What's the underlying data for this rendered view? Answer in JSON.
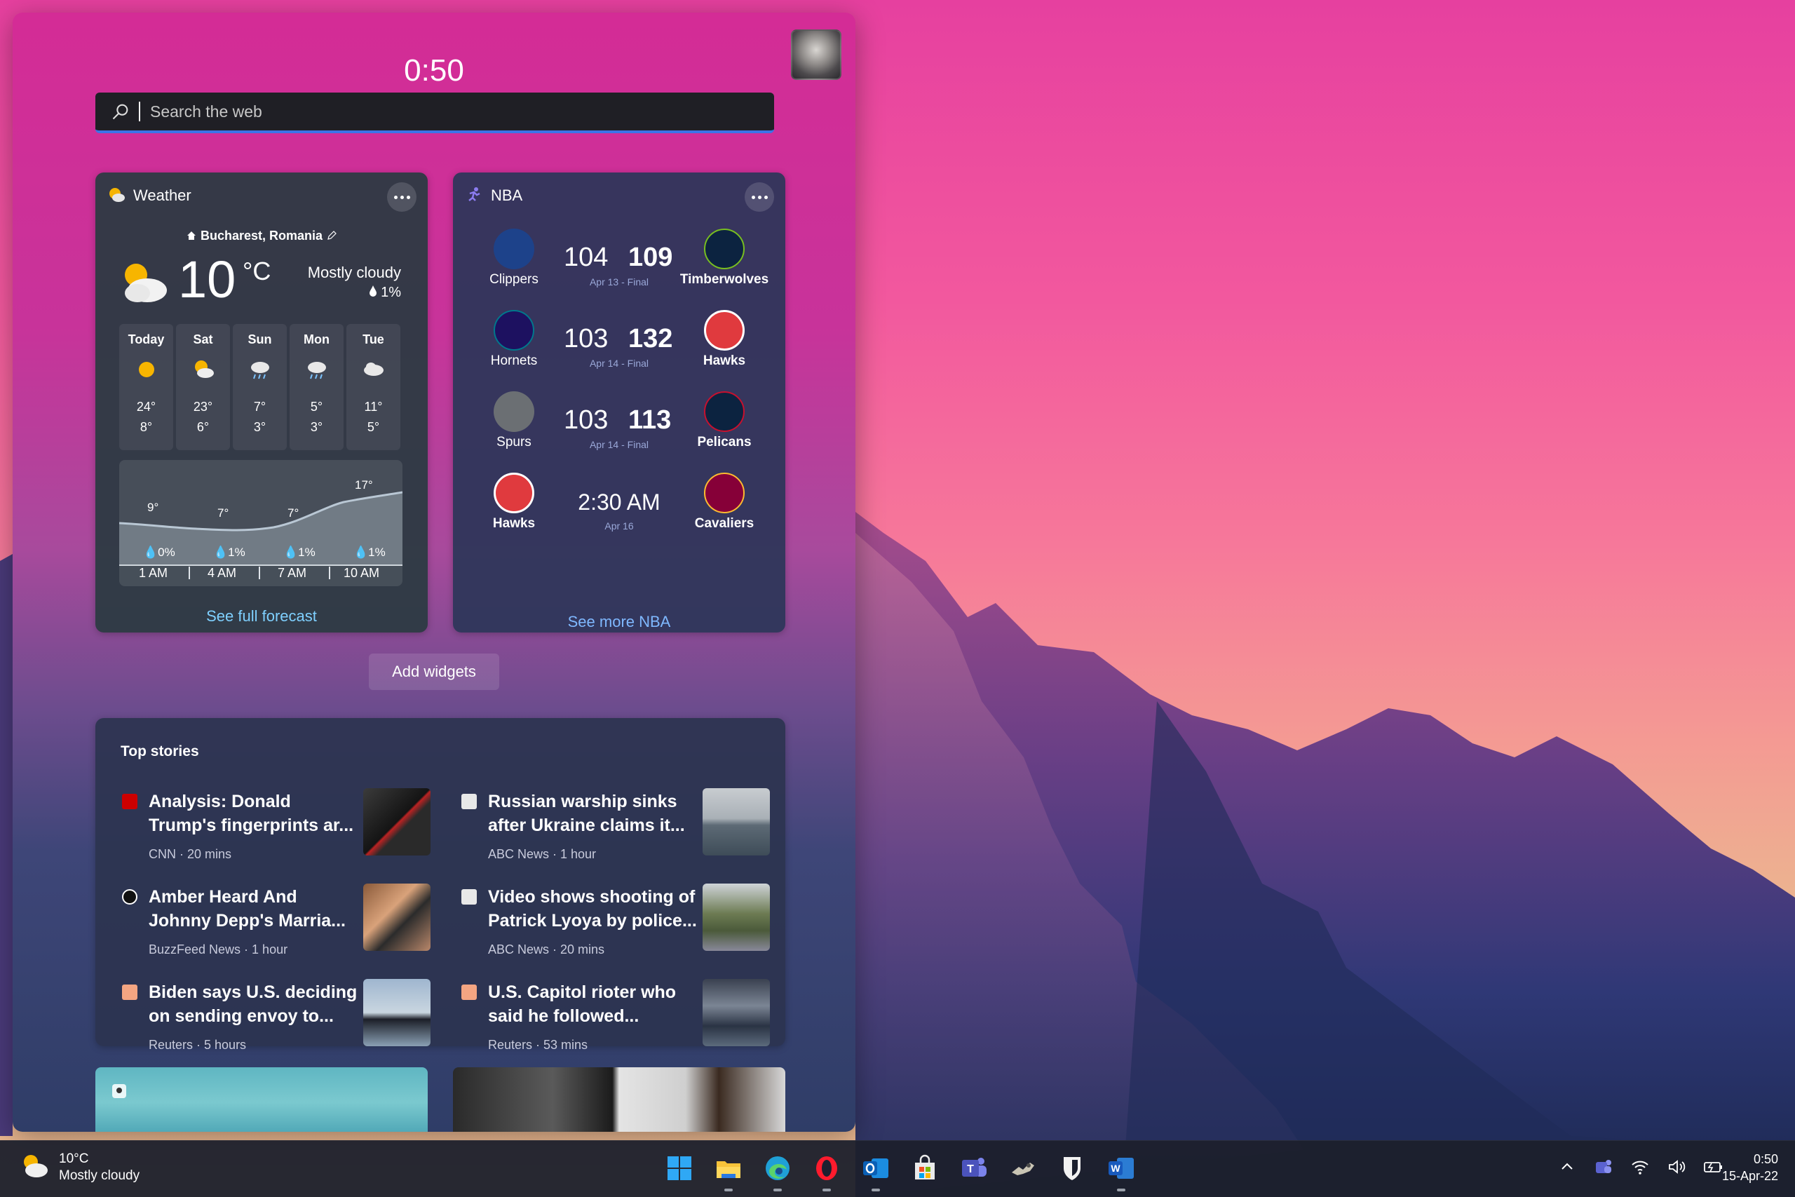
{
  "panel": {
    "time": "0:50",
    "search_placeholder": "Search the web"
  },
  "weather": {
    "title": "Weather",
    "location": "Bucharest, Romania",
    "temp": "10",
    "unit": "°C",
    "condition": "Mostly cloudy",
    "precip": "1%",
    "days": [
      {
        "name": "Today",
        "icon": "sun-icon",
        "hi": "24°",
        "lo": "8°"
      },
      {
        "name": "Sat",
        "icon": "partly-sunny-icon",
        "hi": "23°",
        "lo": "6°"
      },
      {
        "name": "Sun",
        "icon": "rain-icon",
        "hi": "7°",
        "lo": "3°"
      },
      {
        "name": "Mon",
        "icon": "rain-icon",
        "hi": "5°",
        "lo": "3°"
      },
      {
        "name": "Tue",
        "icon": "cloud-icon",
        "hi": "11°",
        "lo": "5°"
      }
    ],
    "hourly": [
      {
        "temp": "9°",
        "precip": "0%",
        "time": "1 AM"
      },
      {
        "temp": "7°",
        "precip": "1%",
        "time": "4 AM"
      },
      {
        "temp": "7°",
        "precip": "1%",
        "time": "7 AM"
      },
      {
        "temp": "17°",
        "precip": "1%",
        "time": "10 AM"
      }
    ],
    "link": "See full forecast"
  },
  "nba": {
    "title": "NBA",
    "games": [
      {
        "home": "Clippers",
        "away": "Timberwolves",
        "home_score": "104",
        "away_score": "109",
        "date": "Apr 13 - Final",
        "home_color": "#1d428a",
        "away_color": "#0c2340"
      },
      {
        "home": "Hornets",
        "away": "Hawks",
        "home_score": "103",
        "away_score": "132",
        "date": "Apr 14 - Final",
        "home_color": "#1d1160",
        "away_color": "#e03a3e"
      },
      {
        "home": "Spurs",
        "away": "Pelicans",
        "home_score": "103",
        "away_score": "113",
        "date": "Apr 14 - Final",
        "home_color": "#c4ced4",
        "away_color": "#0c2340"
      },
      {
        "home": "Hawks",
        "away": "Cavaliers",
        "time": "2:30 AM",
        "date": "Apr 16",
        "home_color": "#e03a3e",
        "away_color": "#860038"
      }
    ],
    "link": "See more NBA"
  },
  "add_widgets": "Add widgets",
  "top_stories": {
    "title": "Top stories",
    "items": [
      {
        "headline": "Analysis: Donald Trump's fingerprints ar...",
        "meta": "CNN · 20 mins",
        "source_icon": "cnn-icon"
      },
      {
        "headline": "Russian warship sinks after Ukraine claims it...",
        "meta": "ABC News · 1 hour",
        "source_icon": "abc-news-icon"
      },
      {
        "headline": "Amber Heard And Johnny Depp's Marria...",
        "meta": "BuzzFeed News · 1 hour",
        "source_icon": "buzzfeed-icon"
      },
      {
        "headline": "Video shows shooting of Patrick Lyoya by police...",
        "meta": "ABC News · 20 mins",
        "source_icon": "abc-news-icon"
      },
      {
        "headline": "Biden says U.S. deciding on sending envoy to...",
        "meta": "Reuters · 5 hours",
        "source_icon": "reuters-icon"
      },
      {
        "headline": "U.S. Capitol rioter who said he followed...",
        "meta": "Reuters · 53 mins",
        "source_icon": "reuters-icon"
      }
    ]
  },
  "taskbar": {
    "weather_temp": "10°C",
    "weather_cond": "Mostly cloudy",
    "apps": [
      "windows-start-icon",
      "file-explorer-icon",
      "edge-icon",
      "opera-icon",
      "outlook-icon",
      "store-icon",
      "teams-icon",
      "app-icon",
      "bitwarden-icon",
      "word-icon"
    ],
    "clock_time": "0:50",
    "clock_date": "15-Apr-22"
  },
  "colors": {
    "accent": "#3c73e6",
    "link": "#7fd0ff"
  }
}
